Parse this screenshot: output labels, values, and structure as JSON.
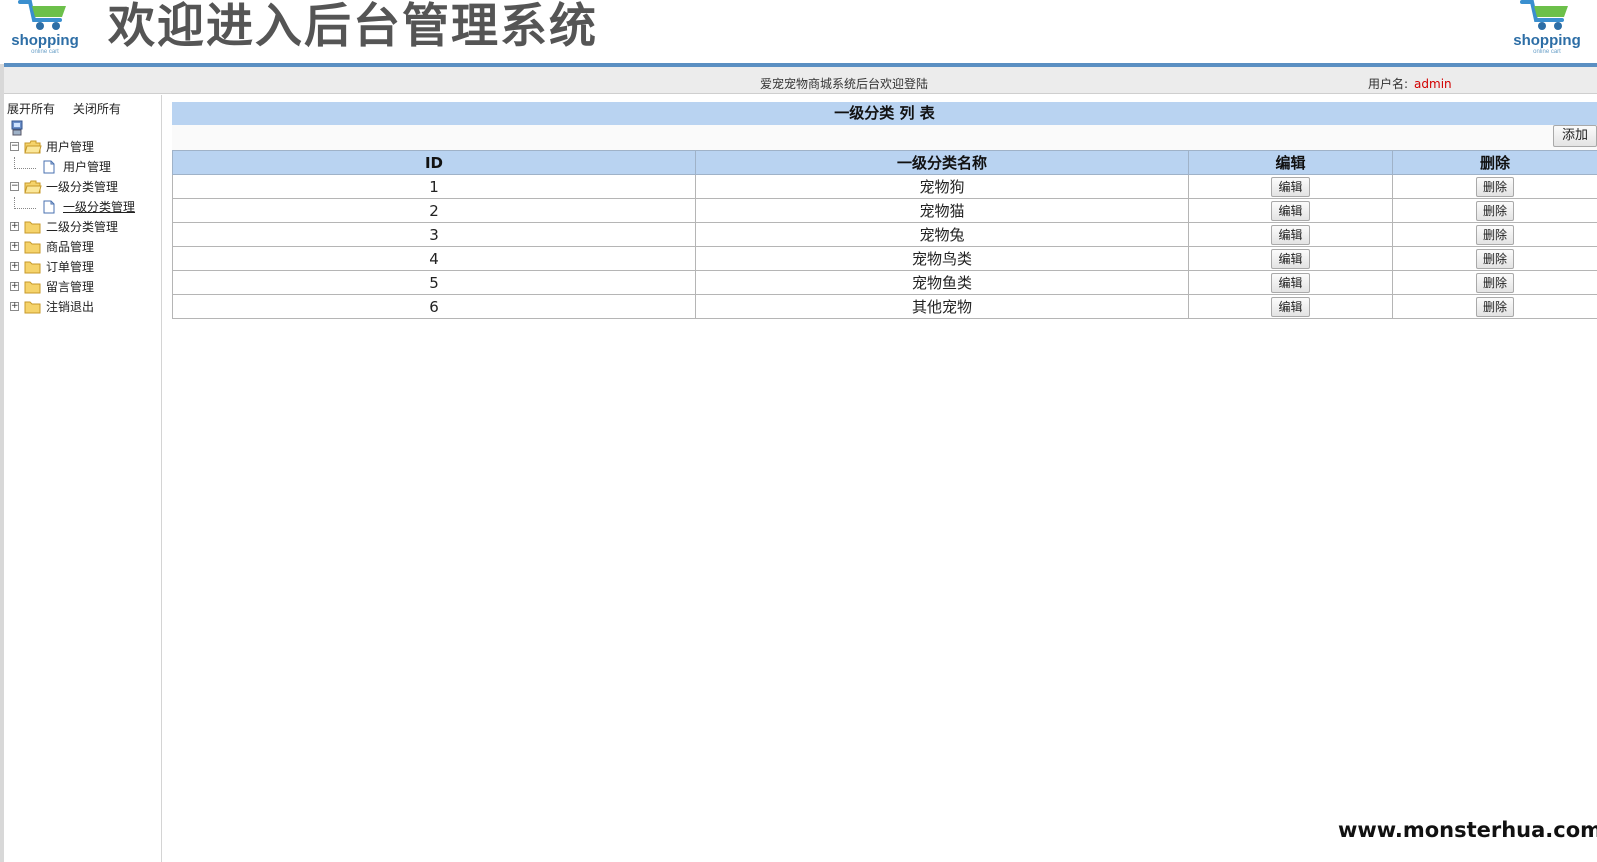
{
  "header": {
    "title": "欢迎进入后台管理系统",
    "logo_text": "shopping",
    "logo_subtext": "online cart"
  },
  "statusbar": {
    "welcome": "爱宠宠物商城系统后台欢迎登陆",
    "user_label": "用户名:",
    "user_name": "admin"
  },
  "sidebar": {
    "expand_all": "展开所有",
    "collapse_all": "关闭所有",
    "tree": [
      {
        "label": "用户管理",
        "toggle": "−",
        "children": [
          "用户管理"
        ]
      },
      {
        "label": "一级分类管理",
        "toggle": "−",
        "children": [
          "一级分类管理"
        ]
      },
      {
        "label": "二级分类管理",
        "toggle": "+"
      },
      {
        "label": "商品管理",
        "toggle": "+"
      },
      {
        "label": "订单管理",
        "toggle": "+"
      },
      {
        "label": "留言管理",
        "toggle": "+"
      },
      {
        "label": "注销退出",
        "toggle": "+"
      }
    ]
  },
  "content": {
    "title": "一级分类 列 表",
    "add_button": "添加",
    "columns": [
      "ID",
      "一级分类名称",
      "编辑",
      "删除"
    ],
    "edit_label": "编辑",
    "delete_label": "删除",
    "rows": [
      {
        "id": "1",
        "name": "宠物狗"
      },
      {
        "id": "2",
        "name": "宠物猫"
      },
      {
        "id": "3",
        "name": "宠物兔"
      },
      {
        "id": "4",
        "name": "宠物鸟类"
      },
      {
        "id": "5",
        "name": "宠物鱼类"
      },
      {
        "id": "6",
        "name": "其他宠物"
      }
    ]
  },
  "watermark": "www.monsterhua.com",
  "colors": {
    "accent_blue": "#5a8fc2",
    "table_header": "#b9d3f1",
    "username_red": "#d20000"
  }
}
